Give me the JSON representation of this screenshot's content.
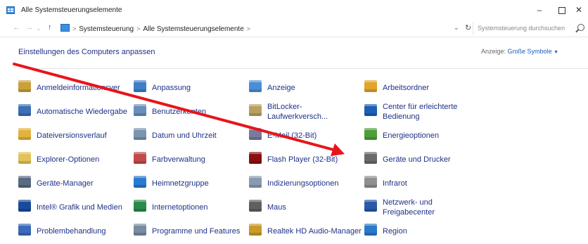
{
  "window": {
    "title": "Alle Systemsteuerungselemente"
  },
  "address": {
    "crumbs": [
      "Systemsteuerung",
      "Alle Systemsteuerungselemente"
    ],
    "search_placeholder": "Systemsteuerung durchsuchen"
  },
  "header": {
    "title": "Einstellungen des Computers anpassen",
    "view_label": "Anzeige:",
    "view_value": "Große Symbole"
  },
  "items": [
    {
      "label": "Anmeldeinformationsver",
      "icon": "credential-manager-icon",
      "color": "#c9a13b"
    },
    {
      "label": "Anpassung",
      "icon": "personalization-icon",
      "color": "#3f7fc9"
    },
    {
      "label": "Anzeige",
      "icon": "display-icon",
      "color": "#4a8fd6"
    },
    {
      "label": "Arbeitsordner",
      "icon": "work-folders-icon",
      "color": "#e0a52a"
    },
    {
      "label": "Automatische Wiedergabe",
      "icon": "autoplay-icon",
      "color": "#3b6fb6"
    },
    {
      "label": "Benutzerkonten",
      "icon": "user-accounts-icon",
      "color": "#6b8fb8"
    },
    {
      "label": "BitLocker-Laufwerkversch...",
      "icon": "bitlocker-key-icon",
      "color": "#b8a060"
    },
    {
      "label": "Center für erleichterte Bedienung",
      "icon": "ease-of-access-icon",
      "color": "#1d5fb3"
    },
    {
      "label": "Dateiversionsverlauf",
      "icon": "file-history-icon",
      "color": "#e3b23c"
    },
    {
      "label": "Datum und Uhrzeit",
      "icon": "date-time-icon",
      "color": "#7a95b0"
    },
    {
      "label": "E-Mail (32-Bit)",
      "icon": "mail-icon",
      "color": "#7a7a9a"
    },
    {
      "label": "Energieoptionen",
      "icon": "power-options-icon",
      "color": "#4f9e3a"
    },
    {
      "label": "Explorer-Optionen",
      "icon": "explorer-options-icon",
      "color": "#e2c25a"
    },
    {
      "label": "Farbverwaltung",
      "icon": "color-management-icon",
      "color": "#c24a4a"
    },
    {
      "label": "Flash Player (32-Bit)",
      "icon": "flash-player-icon",
      "color": "#8a1010"
    },
    {
      "label": "Geräte und Drucker",
      "icon": "devices-printers-icon",
      "color": "#6a6a6a"
    },
    {
      "label": "Geräte-Manager",
      "icon": "device-manager-icon",
      "color": "#5a6a80"
    },
    {
      "label": "Heimnetzgruppe",
      "icon": "homegroup-icon",
      "color": "#2a7ad0"
    },
    {
      "label": "Indizierungsoptionen",
      "icon": "indexing-options-icon",
      "color": "#8a9ab0"
    },
    {
      "label": "Infrarot",
      "icon": "infrared-icon",
      "color": "#909090"
    },
    {
      "label": "Intel® Grafik und Medien",
      "icon": "intel-graphics-icon",
      "color": "#1a4a9a"
    },
    {
      "label": "Internetoptionen",
      "icon": "internet-options-icon",
      "color": "#2a8a4a"
    },
    {
      "label": "Maus",
      "icon": "mouse-icon",
      "color": "#606060"
    },
    {
      "label": "Netzwerk- und Freigabecenter",
      "icon": "network-sharing-icon",
      "color": "#2a5aa8"
    },
    {
      "label": "Problembehandlung",
      "icon": "troubleshooting-icon",
      "color": "#3a6ab8"
    },
    {
      "label": "Programme und Features",
      "icon": "programs-features-icon",
      "color": "#7a8aa0"
    },
    {
      "label": "Realtek HD Audio-Manager",
      "icon": "realtek-audio-icon",
      "color": "#c89a2a"
    },
    {
      "label": "Region",
      "icon": "region-globe-icon",
      "color": "#2a7ac8"
    }
  ],
  "annotation": {
    "color": "#e8141b"
  }
}
